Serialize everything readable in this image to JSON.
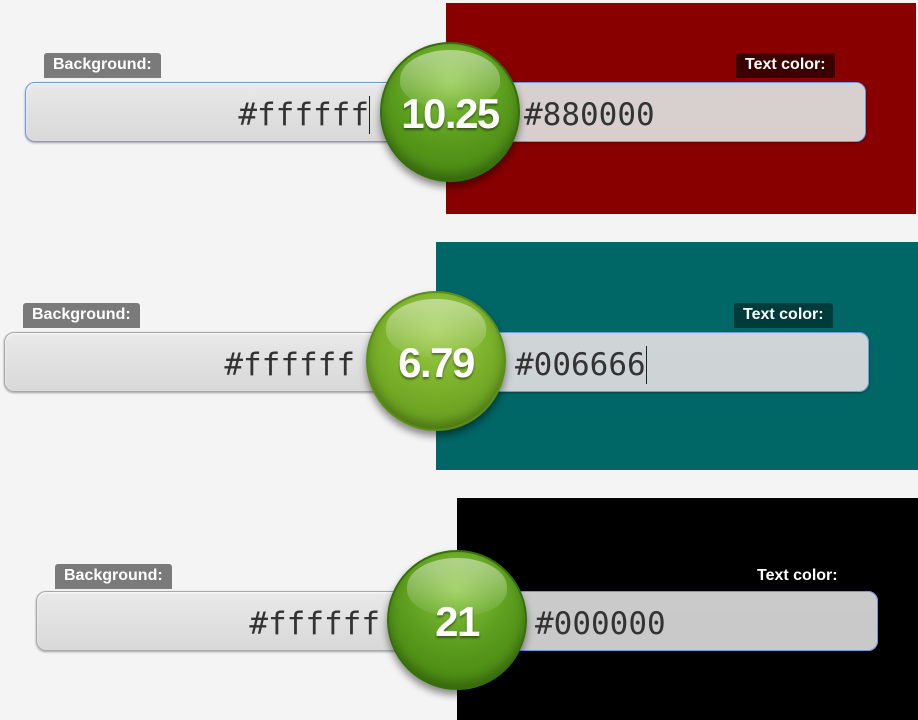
{
  "pairs": [
    {
      "background_label": "Background:",
      "text_color_label": "Text color:",
      "background_value": "#ffffff",
      "text_color_value": "#880000",
      "ratio": "10.25",
      "preview_color": "#880000",
      "ratio_style": "dark-green"
    },
    {
      "background_label": "Background:",
      "text_color_label": "Text color:",
      "background_value": "#ffffff",
      "text_color_value": "#006666",
      "ratio": "6.79",
      "preview_color": "#006666",
      "ratio_style": "light-green"
    },
    {
      "background_label": "Background:",
      "text_color_label": "Text color:",
      "background_value": "#ffffff",
      "text_color_value": "#000000",
      "ratio": "21",
      "preview_color": "#000000",
      "ratio_style": "dark-green"
    }
  ],
  "colors": {
    "label_bg": "#7a7a7a",
    "text_label_bg_dark": "#3a0000",
    "text_label_bg_teal": "#003b3b"
  }
}
